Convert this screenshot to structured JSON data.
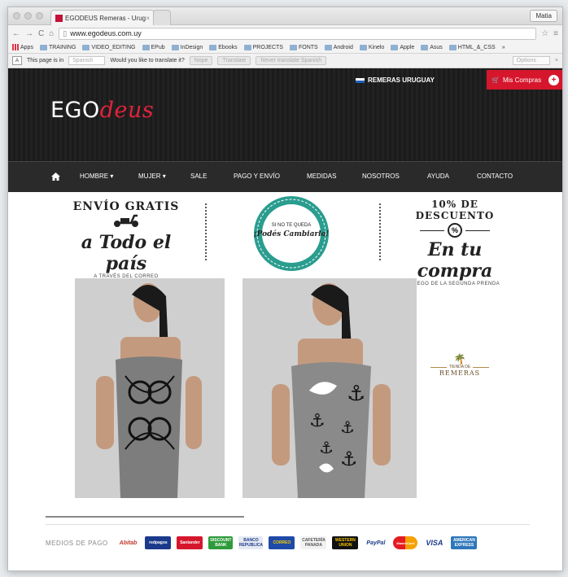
{
  "browser": {
    "tab_title": "EGODEUS Remeras - Urug",
    "tab_close": "×",
    "profile": "Matia",
    "url": "www.egodeus.com.uy",
    "bookmarks": [
      "Apps",
      "TRAINING",
      "VIDEO_EDITING",
      "EPub",
      "InDesign",
      "Ebooks",
      "PROJECTS",
      "FONTS",
      "Android",
      "Kinelo",
      "Apple",
      "Asus",
      "HTML_&_CSS"
    ],
    "bookmarks_more": "»",
    "translate": {
      "prefix": "This page is in",
      "language": "Spanish",
      "question": "Would you like to translate it?",
      "nope": "Nope",
      "translate": "Translate",
      "never": "Never translate Spanish",
      "options": "Options"
    }
  },
  "site": {
    "top_link": "REMERAS URUGUAY",
    "cart_label": "Mis Compras",
    "logo_left": "EGO",
    "logo_right": "deus",
    "nav": [
      "HOMBRE ▾",
      "MUJER ▾",
      "SALE",
      "PAGO Y ENVÍO",
      "MEDIDAS",
      "NOSOTROS",
      "AYUDA",
      "CONTACTO"
    ],
    "promo_left": {
      "arc": "ENVÍO GRATIS",
      "script": "a Todo el país",
      "note": "A TRAVÉS DEL CORREO"
    },
    "seal": {
      "top": "SI NO TE QUEDA",
      "script": "¡Podés Cambiarla!"
    },
    "promo_right": {
      "arc": "10% DE DESCUENTO",
      "badge": "%",
      "script": "En tu compra",
      "note": "LUEGO DE LA SEGUNDA PRENDA"
    },
    "tienda": {
      "top": "TIENDA DE",
      "label": "REMERAS"
    },
    "payments_label": "MEDIOS DE PAGO",
    "payments": [
      "Abitab",
      "redpagos",
      "Santander",
      "DISCOUNT BANK",
      "BANCO REPUBLICA",
      "CORREO",
      "CAFETERÍA PANADA",
      "WESTERN UNION",
      "PayPal",
      "MasterCard",
      "VISA",
      "AMERICAN EXPRESS"
    ]
  },
  "colors": {
    "brand_red": "#d6162c",
    "seal_teal": "#2a9d8f",
    "header_dark": "#1e1e1e"
  }
}
